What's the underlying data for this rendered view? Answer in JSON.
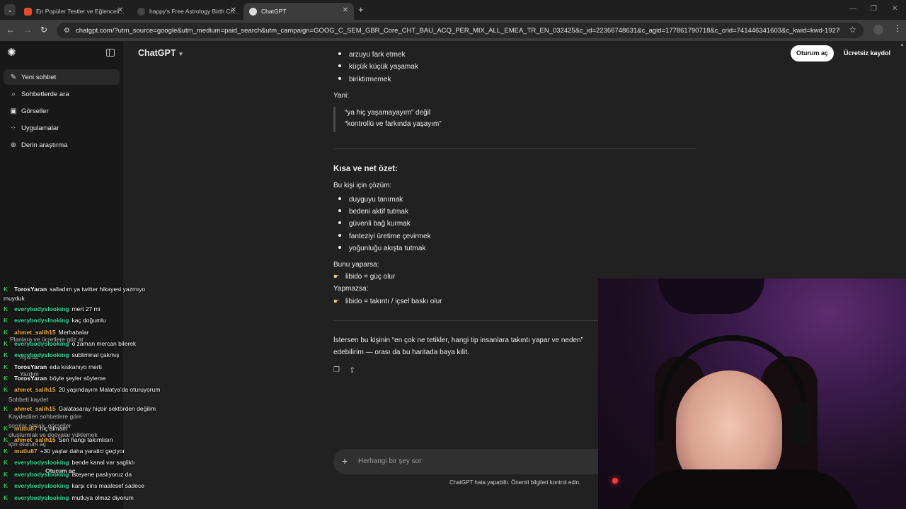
{
  "browser": {
    "tabs": [
      {
        "title": "En Popüler Testler ve Eğlenceli...",
        "active": false
      },
      {
        "title": "happy's Free Astrology Birth Ch...",
        "active": false
      },
      {
        "title": "ChatGPT",
        "active": true
      }
    ],
    "url": "chatgpt.com/?utm_source=google&utm_medium=paid_search&utm_campaign=GOOG_C_SEM_GBR_Core_CHT_BAU_ACQ_PER_MIX_ALL_EMEA_TR_EN_032425&c_id=22366748631&c_agid=177861790718&c_crid=741446341603&c_kwid=kwd-1927051708782&c_i...",
    "icons": {
      "back": "back-arrow-icon",
      "forward": "forward-arrow-icon",
      "reload": "reload-icon",
      "star": "star-icon"
    }
  },
  "sidebar": {
    "items": [
      {
        "label": "Yeni sohbet",
        "icon": "edit-icon"
      },
      {
        "label": "Sohbetlerde ara",
        "icon": "search-icon"
      },
      {
        "label": "Görseller",
        "icon": "images-icon"
      },
      {
        "label": "Uygulamalar",
        "icon": "apps-icon"
      },
      {
        "label": "Derin araştırma",
        "icon": "research-icon"
      }
    ]
  },
  "header": {
    "model": "ChatGPT",
    "login": "Oturum aç",
    "signup": "Ücretsiz kaydol"
  },
  "message": {
    "top_bullets": [
      "arzuyu fark etmek",
      "küçük küçük yaşamak",
      "biriktirmemek"
    ],
    "yani": "Yani:",
    "quote_lines": [
      "“ya hiç yaşamayayım” değil",
      "“kontrollü ve farkında yaşayım”"
    ],
    "summary_title": "Kısa ve net özet:",
    "solution_intro": "Bu kişi için çözüm:",
    "solution_bullets": [
      "duyguyu tanımak",
      "bedeni aktif tutmak",
      "güvenli bağ kurmak",
      "fanteziyi üretime çevirmek",
      "yoğunluğu akışta tutmak"
    ],
    "if_yes": "Bunu yaparsa:",
    "if_yes_result": "libido = güç olur",
    "if_no": "Yapmazsa:",
    "if_no_result": "libido = takıntı / içsel baskı olur",
    "closing_line1": "İstersen bu kişinin “en çok ne tetikler, hangi tip insanlara takıntı yapar ve neden”",
    "closing_line2": "edebilirim — orası da bu haritada baya kilit."
  },
  "composer": {
    "placeholder": "Herhangi bir şey sor",
    "disclaimer": "ChatGPT hata yapabilir. Önemli bilgileri kontrol edin."
  },
  "stream_chat": [
    {
      "user": "TorosYaran",
      "color": "#ffffff",
      "text": "salladım ya twitter hikayesi yazmıyo muyduk"
    },
    {
      "user": "everybodyslooking",
      "color": "#35e0a0",
      "text": "mert 27 mi"
    },
    {
      "user": "everybodyslooking",
      "color": "#35e0a0",
      "text": "kaç doğumlu"
    },
    {
      "user": "ahmet_salih15",
      "color": "#f0b33a",
      "text": "Merhabalar"
    },
    {
      "user": "everybodyslooking",
      "color": "#35e0a0",
      "text": "o zaman mercan bilerek"
    },
    {
      "user": "everybodyslooking",
      "color": "#35e0a0",
      "text": "subliminal çakmış"
    },
    {
      "user": "TorosYaran",
      "color": "#ffffff",
      "text": "eda kıskanıyo merti"
    },
    {
      "user": "TorosYaran",
      "color": "#ffffff",
      "text": "böyle şeyler söyleme"
    },
    {
      "user": "ahmet_salih15",
      "color": "#f0b33a",
      "text": "20 yaşındayım Malatya'da oturuyorum"
    },
    {
      "user": "ahmet_salih15",
      "color": "#f0b33a",
      "text": "Galatasaray hiçbir sektörden değilim"
    },
    {
      "user": "mutlu87",
      "color": "#f0b33a",
      "text": "hiç almam"
    },
    {
      "user": "ahmet_salih15",
      "color": "#f0b33a",
      "text": "Sen hangi takımlısın"
    },
    {
      "user": "mutlu87",
      "color": "#f0b33a",
      "text": "+30 yaşlar daha yaratici geçiyor"
    },
    {
      "user": "everybodyslooking",
      "color": "#35e0a0",
      "text": "bende kanal var sagliklı"
    },
    {
      "user": "everybodyslooking",
      "color": "#35e0a0",
      "text": "isteyene paslıyoruz da"
    },
    {
      "user": "everybodyslooking",
      "color": "#35e0a0",
      "text": "karşı cins maalesef sadece"
    },
    {
      "user": "everybodyslooking",
      "color": "#35e0a0",
      "text": "mutluya olmaz diyorum"
    }
  ],
  "ghost_sidebar": {
    "plans": "Planlara ve ücretlere göz at",
    "settings": "Ayarlar",
    "help": "Yardım",
    "save_chat": "Sohbeti kaydet",
    "saved_line": "Kaydedilen sohbetlere göre",
    "images_line": "sorular almak, görseller",
    "create_line": "oluşturmak ve dosyalar yüklemek",
    "login_line": "için oturum aç",
    "login_btn": "Oturum aç"
  },
  "webcam": {
    "description_icon": "webcam-feed"
  }
}
